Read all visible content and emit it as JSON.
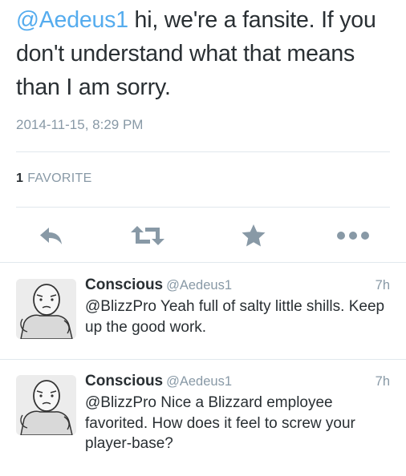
{
  "tweet": {
    "mention": "@Aedeus1",
    "text": " hi, we're a fansite. If you don't understand what that means than I am sorry.",
    "timestamp": "2014-11-15, 8:29 PM",
    "favorites_count": "1",
    "favorites_label": "FAVORITE"
  },
  "actions": {
    "reply_icon": "reply-icon",
    "retweet_icon": "retweet-icon",
    "favorite_icon": "star-icon",
    "more_icon": "more-icon",
    "icon_color": "#8899a6"
  },
  "replies": [
    {
      "name": "Conscious",
      "handle": "@Aedeus1",
      "age": "7h",
      "text": "@BlizzPro Yeah full of salty little shills. Keep up the good work."
    },
    {
      "name": "Conscious",
      "handle": "@Aedeus1",
      "age": "7h",
      "text": "@BlizzPro Nice a Blizzard employee favorited. How does it feel to screw your player-base?"
    }
  ],
  "colors": {
    "link": "#55acee",
    "text": "#292f33",
    "muted": "#8899a6",
    "divider": "#e1e8ed"
  }
}
